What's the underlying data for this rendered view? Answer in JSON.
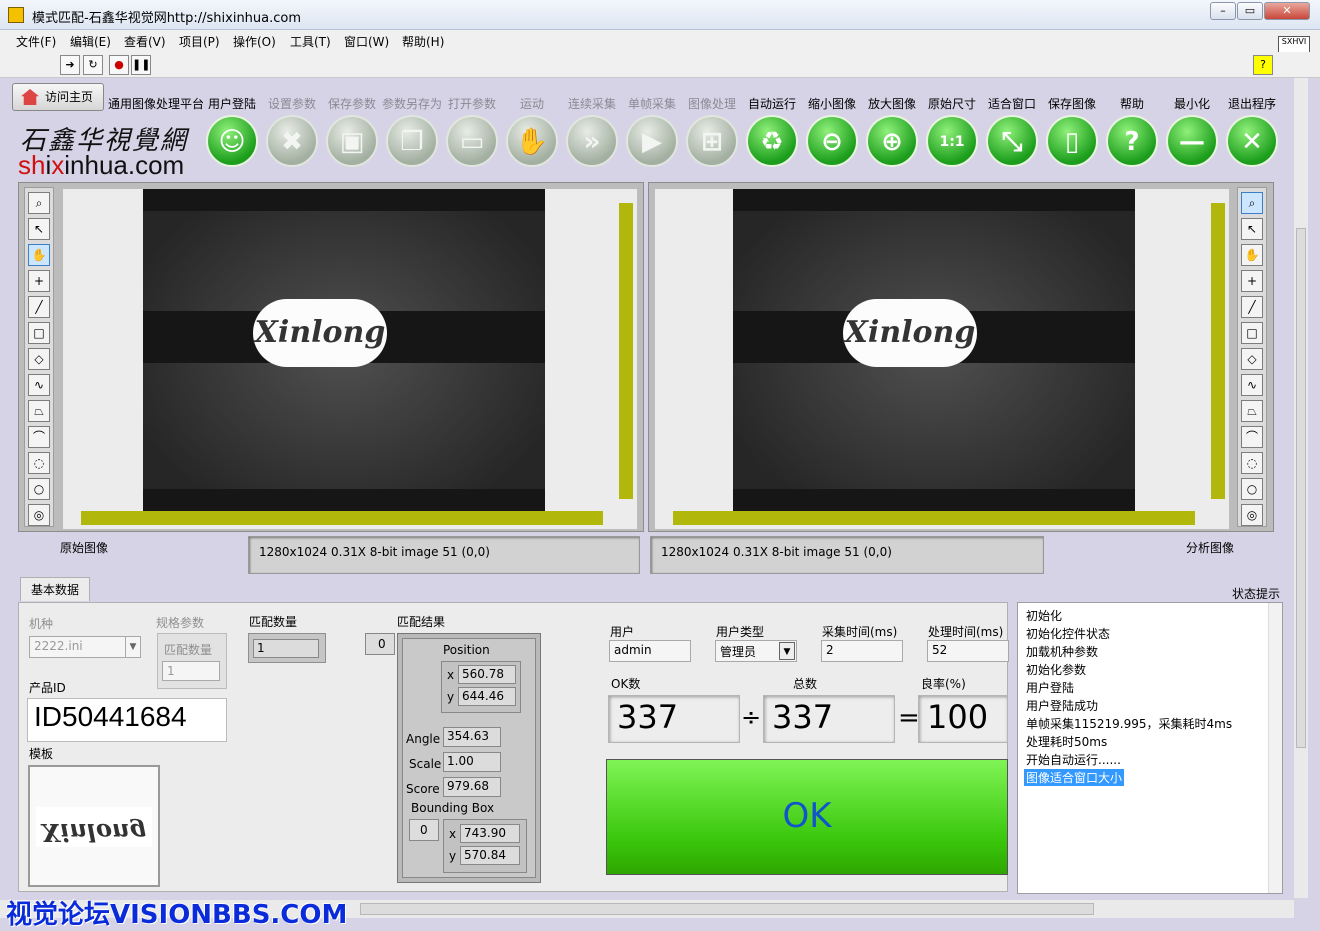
{
  "window": {
    "title": "模式匹配-石鑫华视觉网http://shixinhua.com"
  },
  "menu": [
    "文件(F)",
    "编辑(E)",
    "查看(V)",
    "项目(P)",
    "操作(O)",
    "工具(T)",
    "窗口(W)",
    "帮助(H)"
  ],
  "home": {
    "label": "访问主页"
  },
  "platform_label": "通用图像处理平台",
  "logo": {
    "cn": "石鑫华視覺網",
    "en_pre": "sh",
    "en_x": "i",
    "en_mid": "x",
    "en_i2": "i",
    "en_rest": "nhua.com"
  },
  "toolbar_buttons": [
    {
      "label": "用户登陆",
      "icon": "user-icon",
      "state": "active"
    },
    {
      "label": "设置参数",
      "icon": "tools-icon",
      "state": "disabled"
    },
    {
      "label": "保存参数",
      "icon": "floppy-icon",
      "state": "disabled"
    },
    {
      "label": "参数另存为",
      "icon": "copy-doc-icon",
      "state": "disabled"
    },
    {
      "label": "打开参数",
      "icon": "folder-icon",
      "state": "disabled"
    },
    {
      "label": "运动",
      "icon": "hand-icon",
      "state": "disabled"
    },
    {
      "label": "连续采集",
      "icon": "fast-forward-icon",
      "state": "disabled"
    },
    {
      "label": "单帧采集",
      "icon": "play-icon",
      "state": "disabled"
    },
    {
      "label": "图像处理",
      "icon": "windows-icon",
      "state": "disabled"
    },
    {
      "label": "自动运行",
      "icon": "recycle-icon",
      "state": "active"
    },
    {
      "label": "缩小图像",
      "icon": "zoom-out-icon",
      "state": "active"
    },
    {
      "label": "放大图像",
      "icon": "zoom-in-icon",
      "state": "active"
    },
    {
      "label": "原始尺寸",
      "icon": "zoom-1to1-icon",
      "state": "active"
    },
    {
      "label": "适合窗口",
      "icon": "zoom-fit-icon",
      "state": "active"
    },
    {
      "label": "保存图像",
      "icon": "save-image-icon",
      "state": "active"
    },
    {
      "label": "帮助",
      "icon": "help-icon",
      "state": "active"
    },
    {
      "label": "最小化",
      "icon": "minus-icon",
      "state": "active"
    },
    {
      "label": "退出程序",
      "icon": "close-icon",
      "state": "active"
    }
  ],
  "glyphs": {
    "user-icon": "☺",
    "tools-icon": "✖",
    "floppy-icon": "▣",
    "copy-doc-icon": "❐",
    "folder-icon": "▭",
    "hand-icon": "✋",
    "fast-forward-icon": "»",
    "play-icon": "▶",
    "windows-icon": "⊞",
    "recycle-icon": "♻",
    "zoom-out-icon": "⊖",
    "zoom-in-icon": "⊕",
    "zoom-1to1-icon": "1:1",
    "zoom-fit-icon": "⤡",
    "save-image-icon": "▯",
    "help-icon": "?",
    "minus-icon": "—",
    "close-icon": "✕"
  },
  "image_text": "Xinlong",
  "left_view": {
    "label": "原始图像",
    "info": "1280x1024 0.31X 8-bit image 51     (0,0)"
  },
  "right_view": {
    "label": "分析图像",
    "info": "1280x1024 0.31X 8-bit image 51     (0,0)"
  },
  "status_header": "状态提示",
  "tab_label": "基本数据",
  "model": {
    "label": "机种",
    "value": "2222.ini"
  },
  "spec": {
    "label": "规格参数",
    "inner_label": "匹配数量",
    "value": "1"
  },
  "match_count": {
    "label": "匹配数量",
    "value": "1"
  },
  "product_id": {
    "label": "产品ID",
    "value": "ID50441684"
  },
  "template": {
    "label": "模板",
    "text": "Xinlong"
  },
  "match_result": {
    "label": "匹配结果",
    "index": "0",
    "position_label": "Position",
    "x": "560.78",
    "y": "644.46",
    "angle_label": "Angle",
    "angle": "354.63",
    "scale_label": "Scale",
    "scale": "1.00",
    "score_label": "Score",
    "score": "979.68",
    "bbox_label": "Bounding Box",
    "bbox_index": "0",
    "bx": "743.90",
    "by": "570.84"
  },
  "user": {
    "label": "用户",
    "value": "admin"
  },
  "user_type": {
    "label": "用户类型",
    "value": "管理员"
  },
  "capture_time": {
    "label": "采集时间(ms)",
    "value": "2"
  },
  "process_time": {
    "label": "处理时间(ms)",
    "value": "52"
  },
  "ok_count": {
    "label": "OK数",
    "value": "337"
  },
  "total": {
    "label": "总数",
    "value": "337"
  },
  "yield": {
    "label": "良率(%)",
    "value": "100"
  },
  "ops": {
    "div": "÷",
    "eq": "="
  },
  "result": {
    "text": "OK"
  },
  "status_lines": [
    "初始化",
    "初始化控件状态",
    "加载机种参数",
    "初始化参数",
    "用户登陆",
    "用户登陆成功",
    "单帧采集115219.995，采集耗时4ms",
    "处理耗时50ms",
    "开始自动运行......",
    "图像适合窗口大小"
  ],
  "watermark": "视觉论坛VISIONBBS.COM"
}
